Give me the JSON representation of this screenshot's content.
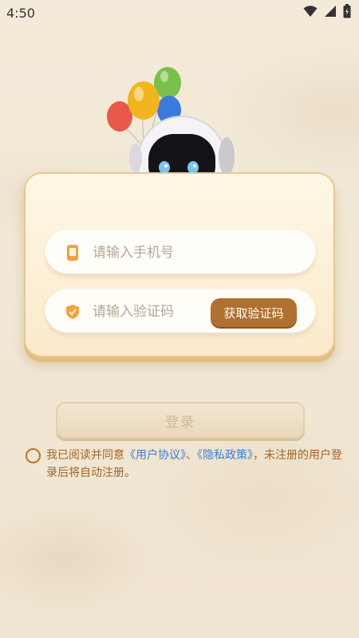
{
  "status_bar": {
    "time": "4:50"
  },
  "login_form": {
    "phone_placeholder": "请输入手机号",
    "code_placeholder": "请输入验证码",
    "get_code_label": "获取验证码"
  },
  "login_button_label": "登录",
  "agreement": {
    "prefix": "我已阅读并同意",
    "user_agreement": "《用户协议》",
    "separator": "、",
    "privacy_policy": "《隐私政策》",
    "suffix": "，未注册的用户登录后将自动注册。"
  },
  "colors": {
    "accent": "#b0702f",
    "link": "#3d7ed8",
    "agreement_text": "#a4652a",
    "background": "#f1e7d4"
  },
  "icons": [
    "wifi-icon",
    "signal-icon",
    "battery-icon",
    "phone-icon",
    "shield-icon"
  ]
}
